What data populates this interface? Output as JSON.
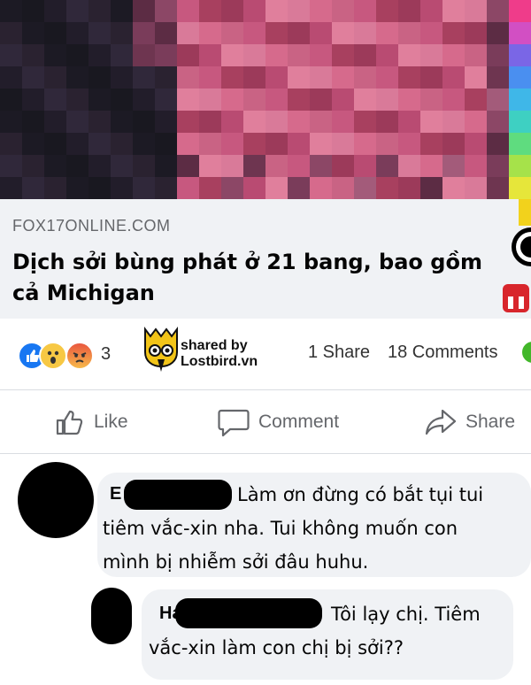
{
  "link_preview": {
    "domain": "FOX17ONLINE.COM",
    "headline": "Dịch sởi bùng phát ở 21 bang, bao gồm cả Michigan"
  },
  "stats": {
    "reaction_count": "3",
    "share_text": "1 Share",
    "comment_text": "18 Comments"
  },
  "watermark": {
    "line1": "shared by",
    "line2": "Lostbird.vn"
  },
  "actions": {
    "like": "Like",
    "comment": "Comment",
    "share": "Share"
  },
  "comments": [
    {
      "name": "E",
      "text": "Làm ơn đừng có bắt tụi tui tiêm vắc-xin nha. Tui không muốn con mình bị nhiễm sởi đâu huhu."
    },
    {
      "name": "Ha",
      "text": "Tôi lạy chị. Tiêm vắc-xin làm con chị bị sởi??"
    }
  ],
  "colors": {
    "facebook_blue": "#1877f2",
    "bubble_bg": "#f0f2f5",
    "muted_text": "#65676b"
  }
}
